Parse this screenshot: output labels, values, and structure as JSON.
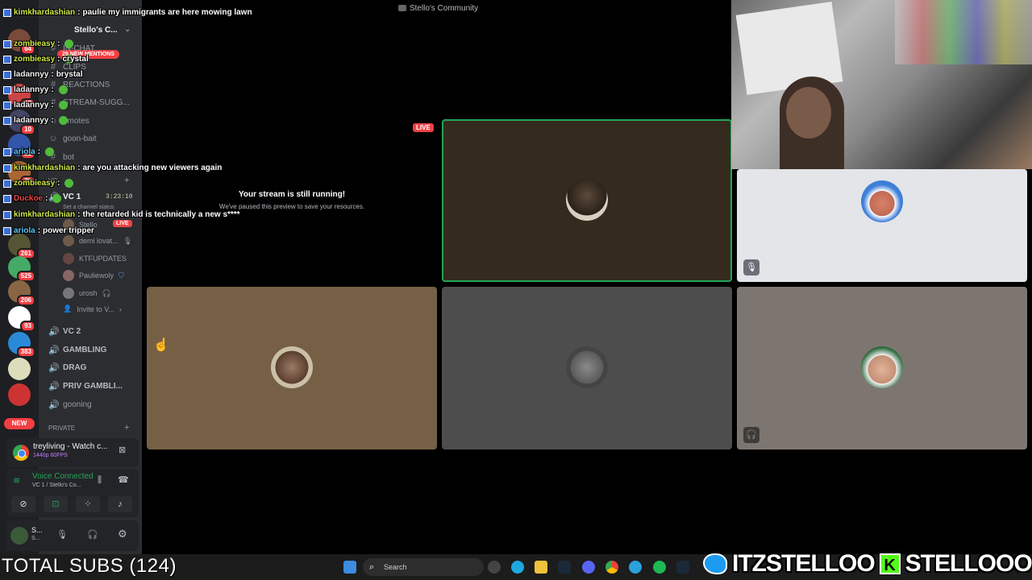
{
  "window": {
    "title": "Stello's Community"
  },
  "rail": {
    "badges": [
      "64",
      "17",
      "10",
      "22",
      "30",
      "261",
      "525",
      "206",
      "93",
      "383"
    ],
    "new_label": "NEW"
  },
  "sidebar": {
    "server_name": "Stello's C...",
    "mentions_pill": "29 NEW MENTIONS",
    "channels": [
      {
        "name": "IN-CHAT",
        "icon": "hash"
      },
      {
        "name": "CLIPS",
        "icon": "hash"
      },
      {
        "name": "REACTIONS",
        "icon": "hash"
      },
      {
        "name": "STREAM-SUGG...",
        "icon": "hash"
      },
      {
        "name": "emotes",
        "icon": "emoji"
      },
      {
        "name": "goon-bait",
        "icon": "emoji"
      },
      {
        "name": "bot",
        "icon": "hash"
      }
    ],
    "vc_category": "VC",
    "vc1": {
      "name": "VC 1",
      "timer": "3:23:10",
      "status": "Set a channel status"
    },
    "members": [
      {
        "name": "Stello",
        "live": "LIVE"
      },
      {
        "name": "demi lovat..."
      },
      {
        "name": "KTFUPDATES"
      },
      {
        "name": "Pauliewoly"
      },
      {
        "name": "urosh"
      }
    ],
    "invite": "Invite to V...",
    "voice_channels": [
      "VC 2",
      "GAMBLING",
      "DRAG",
      "PRIV GAMBLI...",
      "gooning"
    ],
    "private_category": "PRIVATE"
  },
  "stream_panel": {
    "title": "treyliving - Watch c...",
    "quality": "1440p 60FPS"
  },
  "voice_panel": {
    "status": "Voice Connected",
    "location": "VC 1 / Stello's Co..."
  },
  "user_panel": {
    "name": "S...",
    "status": "S..."
  },
  "chat": [
    {
      "user": "kimkhardashian",
      "text": "paulie my immigrants are here mowing lawn",
      "color": "c1"
    },
    {
      "user": "zombieasy",
      "text": "",
      "color": "c1"
    },
    {
      "user": "zombieasy",
      "text": "",
      "color": "c1"
    },
    {
      "user": "zombieasy",
      "text": "crystal",
      "color": "c1"
    },
    {
      "user": "ladannyy",
      "text": "brystal",
      "color": "c2"
    },
    {
      "user": "ladannyy",
      "text": "",
      "color": "c2"
    },
    {
      "user": "ladannyy",
      "text": "",
      "color": "c2"
    },
    {
      "user": "ladannyy",
      "text": "",
      "color": "c2"
    },
    {
      "user": "ariola",
      "text": "",
      "color": "c3"
    },
    {
      "user": "kimkhardashian",
      "text": "are you attacking new viewers again",
      "color": "c1"
    },
    {
      "user": "zombieasy",
      "text": "",
      "color": "c1"
    },
    {
      "user": "Duckoe",
      "text": "",
      "color": "c4"
    },
    {
      "user": "kimkhardashian",
      "text": "the retarded kid is technically a new s****",
      "color": "c1"
    },
    {
      "user": "ariola",
      "text": "power tripper",
      "color": "c3"
    }
  ],
  "stage": {
    "live_label": "LIVE",
    "paused_title": "Your stream is still running!",
    "paused_subtitle": "We've paused this preview to save your resources."
  },
  "taskbar": {
    "search_placeholder": "Search"
  },
  "overlay": {
    "subs": "TOTAL SUBS (124)",
    "twitter_handle": "ITZSTELLOO",
    "kick_handle": "STELLOOO"
  }
}
